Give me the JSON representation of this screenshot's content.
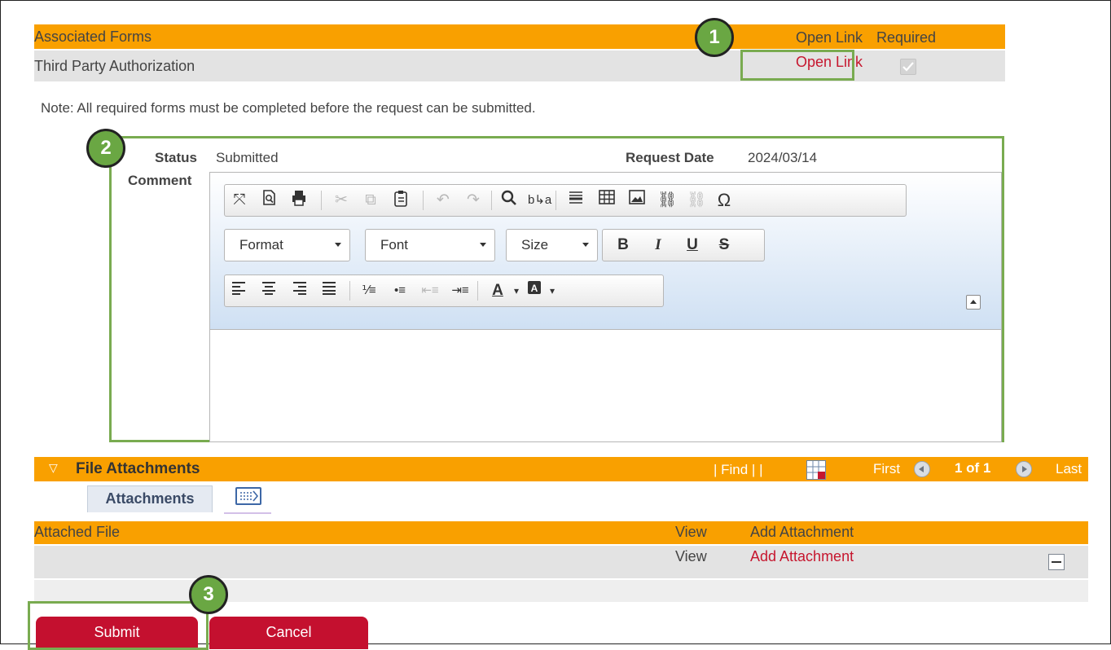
{
  "associated_forms": {
    "header_title": "Associated Forms",
    "col_open_link": "Open Link",
    "col_required": "Required",
    "rows": [
      {
        "form_name": "Third Party Authorization",
        "open_link_text": "Open Link",
        "required": true
      }
    ]
  },
  "note": "Note: All required forms must be completed before the request can be submitted.",
  "request": {
    "status_label": "Status",
    "status_value": "Submitted",
    "request_date_label": "Request Date",
    "request_date_value": "2024/03/14",
    "comment_label": "Comment"
  },
  "editor": {
    "format_combo": "Format",
    "font_combo": "Font",
    "size_combo": "Size",
    "content": ""
  },
  "file_attachments": {
    "section_title": "File Attachments",
    "find_text": "| Find | |",
    "nav_first": "First",
    "nav_count": "1 of 1",
    "nav_last": "Last",
    "tab_label": "Attachments",
    "col_attached_file": "Attached File",
    "col_view": "View",
    "col_add_attachment": "Add Attachment",
    "rows": [
      {
        "attached_file": "",
        "view": "View",
        "add_attachment": "Add Attachment"
      }
    ]
  },
  "buttons": {
    "submit": "Submit",
    "cancel": "Cancel"
  },
  "callouts": [
    "1",
    "2",
    "3"
  ],
  "colors": {
    "header_orange": "#f9a000",
    "link_red": "#c6162e",
    "button_red": "#c4102f",
    "callout_green": "#6aa743",
    "highlight_green": "#79ab50"
  }
}
